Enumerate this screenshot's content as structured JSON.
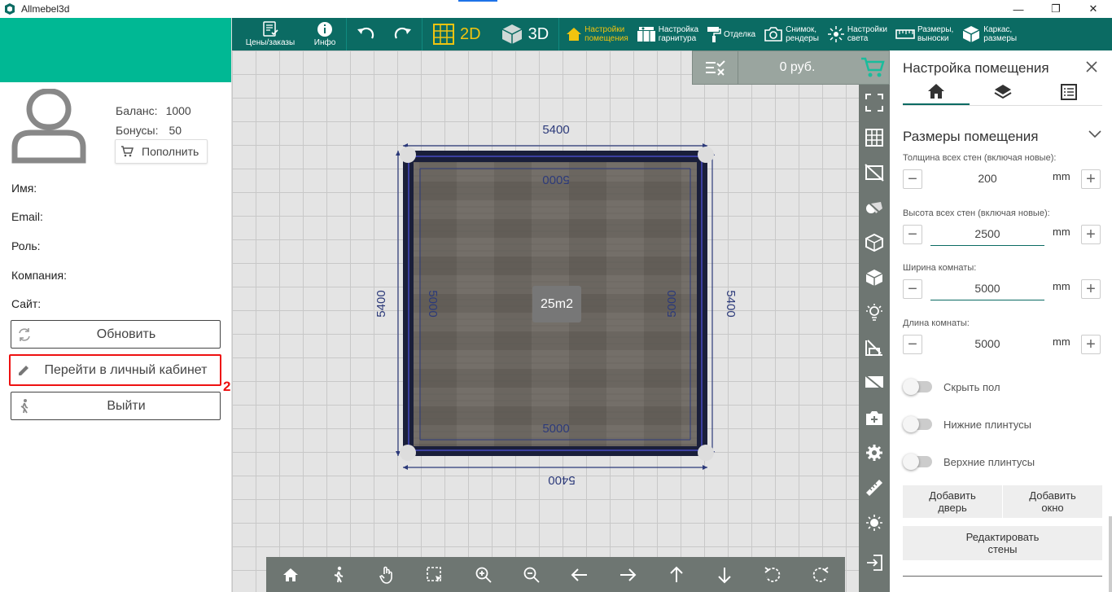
{
  "window": {
    "title": "Allmebel3d",
    "minimize": "—",
    "restore": "❐",
    "close": "✕"
  },
  "user": {
    "balance_label": "Баланс:",
    "balance": "1000",
    "bonus_label": "Бонусы:",
    "bonus": "50",
    "topup": "Пополнить",
    "fields": {
      "name": "Имя:",
      "email": "Email:",
      "role": "Роль:",
      "company": "Компания:",
      "site": "Сайт:"
    },
    "buttons": {
      "refresh": "Обновить",
      "cabinet": "Перейти в личный кабинет",
      "logout": "Выйти"
    },
    "marker": "2"
  },
  "toolbar": {
    "prices": "Цены/заказы",
    "info": "Инфо",
    "mode2d": "2D",
    "mode3d": "3D",
    "room_settings": [
      "Настройки",
      "помещения"
    ],
    "set_settings": [
      "Настройка",
      "гарнитура"
    ],
    "finish": "Отделка",
    "snapshot": [
      "Снимок,",
      "рендеры"
    ],
    "light": [
      "Настройки",
      "света"
    ],
    "sizes": [
      "Размеры,",
      "выноски"
    ],
    "frame": [
      "Каркас,",
      "размеры"
    ],
    "accent_color": "#f1c40f"
  },
  "canvas": {
    "price": "0 руб.",
    "dims": {
      "outer_top": "5400",
      "outer_bottom": "5400",
      "outer_left": "5400",
      "outer_right": "5400",
      "inner_top": "5000",
      "inner_bottom": "5000",
      "inner_left": "5000",
      "inner_right": "5000"
    },
    "area": "25m2"
  },
  "panel": {
    "title": "Настройка помещения",
    "section": "Размеры помещения",
    "wall_thickness_label": "Толщина всех стен (включая новые):",
    "wall_thickness": "200",
    "wall_height_label": "Высота всех стен (включая новые):",
    "wall_height": "2500",
    "room_width_label": "Ширина комнаты:",
    "room_width": "5000",
    "room_length_label": "Длина комнаты:",
    "room_length": "5000",
    "unit": "mm",
    "toggles": {
      "hide_floor": "Скрыть пол",
      "lower_plinth": "Нижние плинтусы",
      "upper_plinth": "Верхние плинтусы"
    },
    "add_door": [
      "Добавить",
      "дверь"
    ],
    "add_window": [
      "Добавить",
      "окно"
    ],
    "edit_walls": [
      "Редактировать",
      "стены"
    ]
  }
}
